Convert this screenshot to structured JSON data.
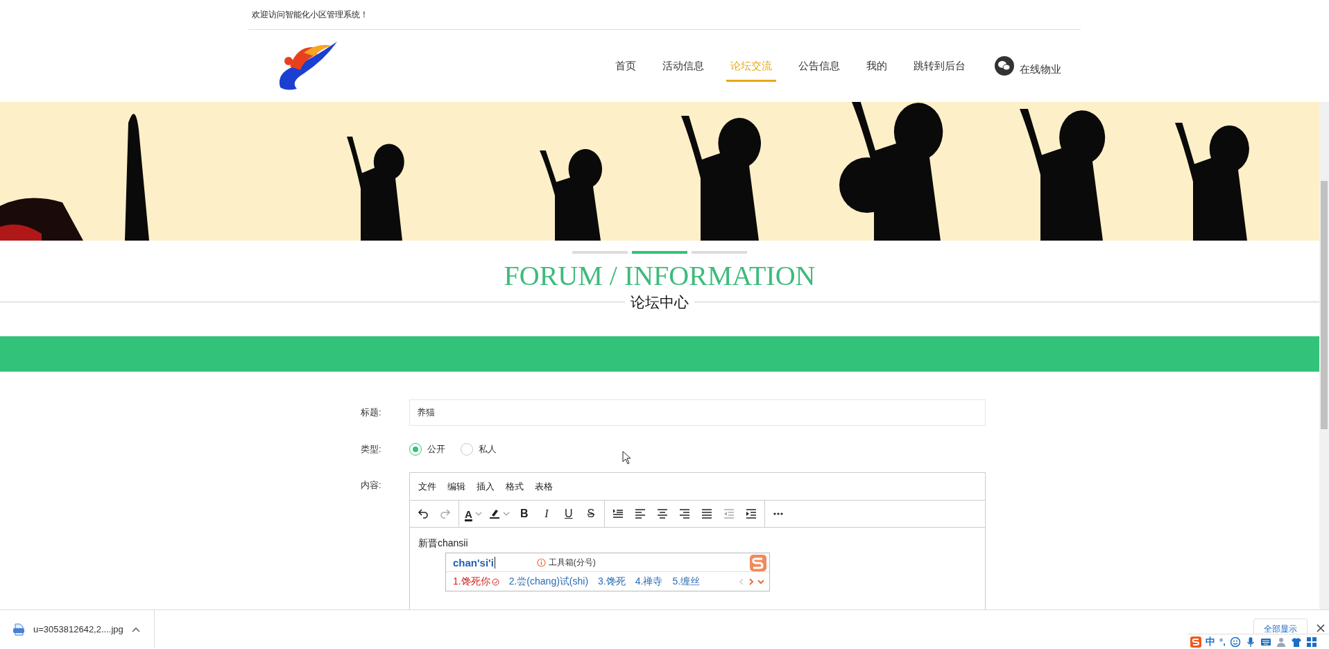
{
  "top_bar": {
    "welcome": "欢迎访问智能化小区管理系统！"
  },
  "nav": [
    {
      "label": "首页",
      "selected": false
    },
    {
      "label": "活动信息",
      "selected": false
    },
    {
      "label": "论坛交流",
      "selected": true
    },
    {
      "label": "公告信息",
      "selected": false
    },
    {
      "label": "我的",
      "selected": false
    },
    {
      "label": "跳转到后台",
      "selected": false
    }
  ],
  "online_service": "在线物业",
  "carousel_dots": [
    {
      "selected": false
    },
    {
      "selected": true
    },
    {
      "selected": false
    }
  ],
  "section": {
    "title": "FORUM / INFORMATION",
    "subtitle": "论坛中心"
  },
  "form": {
    "title_label": "标题:",
    "title_value": "养猫",
    "type_label": "类型:",
    "content_label": "内容:",
    "type_options": [
      {
        "label": "公开",
        "selected": true
      },
      {
        "label": "私人",
        "selected": false
      }
    ]
  },
  "editor": {
    "menu": [
      "文件",
      "编辑",
      "插入",
      "格式",
      "表格"
    ],
    "toolbar_groups": [
      [
        {
          "kind": "undo",
          "disabled": false
        },
        {
          "kind": "redo",
          "disabled": true
        }
      ],
      [
        {
          "kind": "text-color",
          "glyph": "A",
          "disabled": false
        },
        {
          "kind": "highlight",
          "disabled": false
        },
        {
          "kind": "bold",
          "glyph": "B",
          "disabled": false
        },
        {
          "kind": "italic",
          "glyph": "I",
          "disabled": false
        },
        {
          "kind": "underline",
          "glyph": "U",
          "disabled": false
        },
        {
          "kind": "strike",
          "glyph": "S",
          "disabled": false
        }
      ],
      [
        {
          "kind": "line-height",
          "disabled": false
        },
        {
          "kind": "align-left",
          "disabled": false
        },
        {
          "kind": "align-center",
          "disabled": false
        },
        {
          "kind": "align-right",
          "disabled": false
        },
        {
          "kind": "justify",
          "disabled": false
        },
        {
          "kind": "outdent",
          "disabled": true
        },
        {
          "kind": "indent",
          "disabled": false
        }
      ],
      [
        {
          "kind": "more",
          "disabled": false
        }
      ]
    ],
    "text": "新晋chansii"
  },
  "ime": {
    "composition": "chan'si'i",
    "hint": "工具箱(分号)",
    "candidates": [
      {
        "text": "1.馋死你",
        "selected": true
      },
      {
        "text": "2.尝(chang)试(shi)",
        "selected": false
      },
      {
        "text": "3.馋死",
        "selected": false
      },
      {
        "text": "4.禅寺",
        "selected": false
      },
      {
        "text": "5.缠丝",
        "selected": false
      }
    ]
  },
  "download_bar": {
    "file": "u=3053812642,2....jpg",
    "show_all": "全部显示"
  },
  "ime_status": {
    "mode": "中",
    "punct": "°,"
  }
}
